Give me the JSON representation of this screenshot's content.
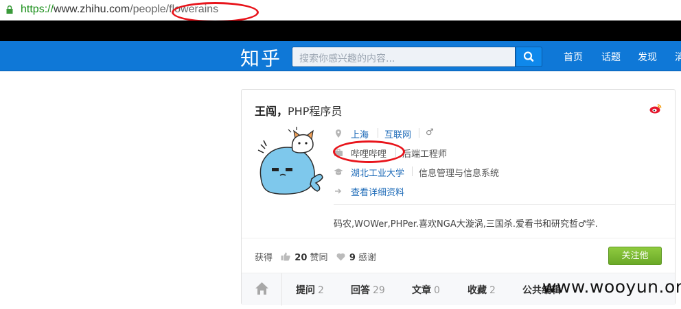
{
  "browser": {
    "url_scheme": "https://",
    "url_host": "www.zhihu.com",
    "url_path": "/people/flowerains"
  },
  "header": {
    "logo": "知乎",
    "search_placeholder": "搜索你感兴趣的内容...",
    "nav": [
      "首页",
      "话题",
      "发现",
      "消"
    ]
  },
  "profile": {
    "name": "王闯",
    "separator": "，",
    "headline": "PHP程序员",
    "location": "上海",
    "industry": "互联网",
    "gender": "♂",
    "company": "哔哩哔哩",
    "position": "后端工程师",
    "school": "湖北工业大学",
    "major": "信息管理与信息系统",
    "detail_link": "查看详细资料",
    "bio": "码农,WOWer,PHPer.喜欢NGA大漩涡,三国杀.爱看书和研究哲♂学."
  },
  "stats": {
    "label": "获得",
    "agree_count": "20",
    "agree_label": "赞同",
    "thanks_count": "9",
    "thanks_label": "感谢"
  },
  "follow_button": "关注他",
  "tabs": [
    {
      "label": "提问",
      "count": "2"
    },
    {
      "label": "回答",
      "count": "29"
    },
    {
      "label": "文章",
      "count": "0"
    },
    {
      "label": "收藏",
      "count": "2"
    },
    {
      "label": "公共编辑",
      "count": ""
    }
  ],
  "watermark": "www.wooyun.org",
  "colors": {
    "header_blue": "#0f78d7",
    "annotation_red": "#e8141b",
    "follow_green": "#7cb936",
    "link_blue": "#1e6bb8"
  }
}
